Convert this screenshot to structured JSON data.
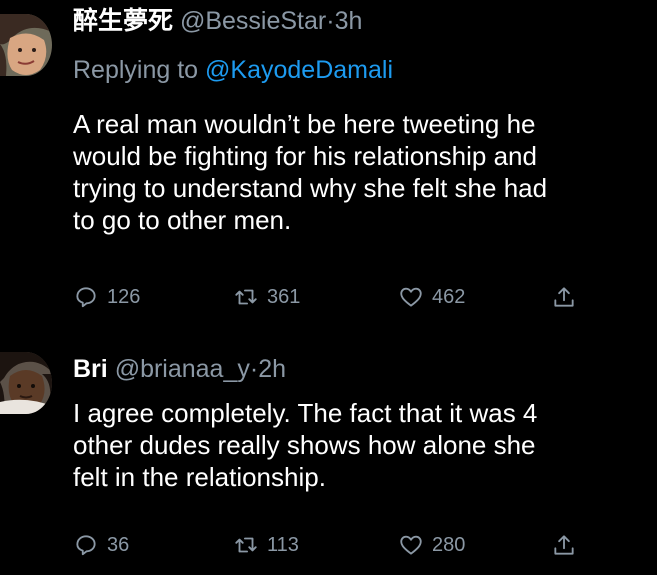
{
  "tweets": [
    {
      "display_name": "醉生夢死",
      "handle": "@BessieStar",
      "separator": "·",
      "time": "3h",
      "replying_prefix": "Replying to",
      "replying_to": "@KayodeDamali",
      "text": "A real man wouldn’t be here tweeting he\nwould be fighting for his relationship and\ntrying to understand why she felt she had\nto go to other men.",
      "replies": "126",
      "retweets": "361",
      "likes": "462",
      "icons": [
        "reply-icon",
        "retweet-icon",
        "like-icon",
        "share-icon"
      ]
    },
    {
      "display_name": "Bri",
      "handle": "@brianaa_y",
      "separator": "·",
      "time": "2h",
      "text": "I agree completely. The fact that it was 4\nother dudes really shows how alone she\nfelt in the relationship.",
      "replies": "36",
      "retweets": "113",
      "likes": "280",
      "icons": [
        "reply-icon",
        "retweet-icon",
        "like-icon",
        "share-icon"
      ]
    }
  ],
  "colors": {
    "background": "#000000",
    "text": "#ffffff",
    "muted": "#8b98a5",
    "link": "#1d9bf0"
  }
}
